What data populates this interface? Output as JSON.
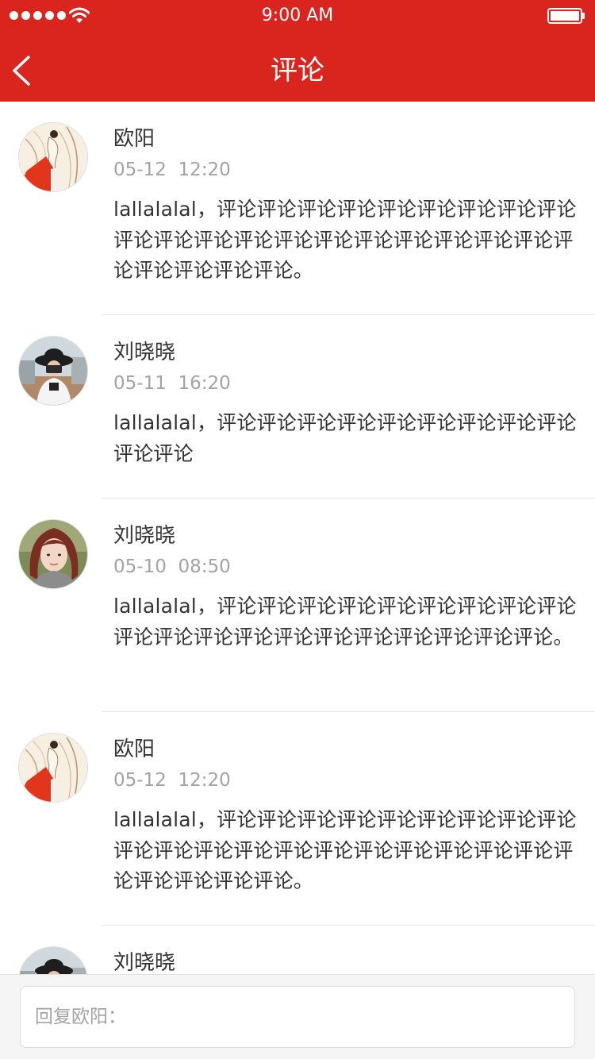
{
  "status_bar": {
    "time": "9:00 AM"
  },
  "header": {
    "title": "评论",
    "back_icon": "chevron-left-icon"
  },
  "comments": [
    {
      "user": "欧阳",
      "time": "05-12  12:20",
      "text": "lallalalal，评论评论评论评论评论评论评论评论评论评论评论评论评论评论评论评论评论评论评论评论评论评论评论评论评论。",
      "avatar": "avatar-illustration-red"
    },
    {
      "user": "刘晓晓",
      "time": "05-11  16:20",
      "text": "lallalalal，评论评论评论评论评论评论评论评论评论评论评论",
      "avatar": "avatar-photo-hat"
    },
    {
      "user": "刘晓晓",
      "time": "05-10  08:50",
      "text": "lallalalal，评论评论评论评论评论评论评论评论评论评论评论评论评论评论评论评论评论评论评论评论。",
      "avatar": "avatar-photo-portrait"
    },
    {
      "user": "欧阳",
      "time": "05-12  12:20",
      "text": "lallalalal，评论评论评论评论评论评论评论评论评论评论评论评论评论评论评论评论评论评论评论评论评论评论评论评论评论。",
      "avatar": "avatar-illustration-red"
    },
    {
      "user": "刘晓晓",
      "time": "",
      "text": "",
      "avatar": "avatar-photo-hat"
    }
  ],
  "reply": {
    "placeholder": "回复欧阳："
  },
  "colors": {
    "brand_red": "#d9251d",
    "text_primary": "#333333",
    "text_secondary": "#a3a3a3",
    "divider": "#e3e3e3"
  }
}
